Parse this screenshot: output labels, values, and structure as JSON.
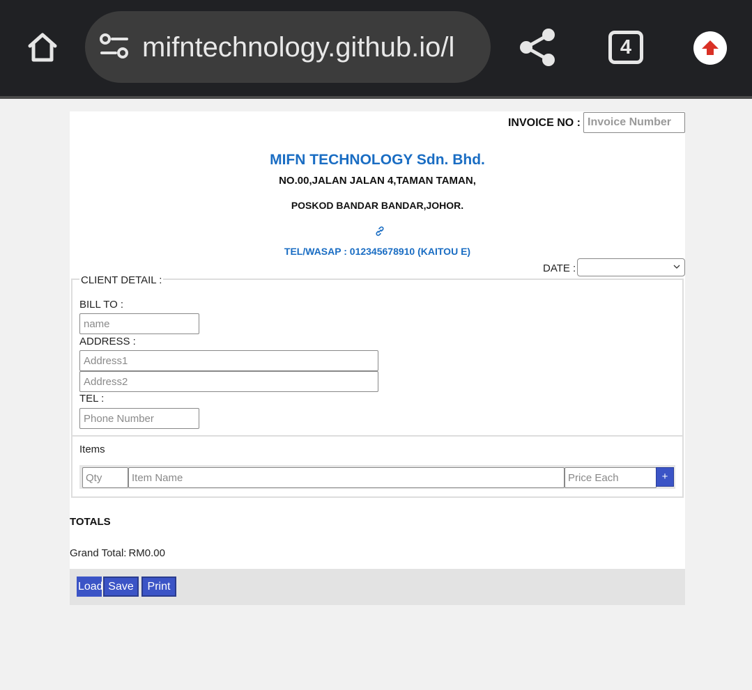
{
  "browser": {
    "url": "mifntechnology.github.io/l",
    "tab_count": "4",
    "icons": [
      "home-icon",
      "page-info-icon",
      "share-icon",
      "tab-switcher-icon",
      "update-icon"
    ]
  },
  "invoice": {
    "number_label": "INVOICE NO :",
    "number_placeholder": "Invoice Number",
    "company_name": "MIFN TECHNOLOGY Sdn. Bhd.",
    "address_line1": "NO.00,JALAN JALAN 4,TAMAN TAMAN,",
    "address_line2": "POSKOD BANDAR BANDAR,JOHOR.",
    "tel": "TEL/WASAP : 012345678910 (KAITOU E)",
    "date_label": "DATE :",
    "date_value": ""
  },
  "client": {
    "legend": "CLIENT DETAIL :",
    "bill_to_label": "BILL TO :",
    "name_placeholder": "name",
    "address_label": "ADDRESS :",
    "address1_placeholder": "Address1",
    "address2_placeholder": "Address2",
    "tel_label": "TEL :",
    "phone_placeholder": "Phone Number"
  },
  "items": {
    "title": "Items",
    "qty_placeholder": "Qty",
    "name_placeholder": "Item Name",
    "price_placeholder": "Price Each",
    "add_label": "+"
  },
  "totals": {
    "heading": "TOTALS",
    "grand_total_label": "Grand Total:",
    "grand_total_value": "RM0.00"
  },
  "actions": {
    "load_label": "Load",
    "save_label": "Save",
    "print_label": "Print"
  },
  "colors": {
    "brand_blue": "#1a6dc3",
    "button_blue": "#3b54c6",
    "chrome_dark": "#202124",
    "update_red": "#d93025"
  }
}
